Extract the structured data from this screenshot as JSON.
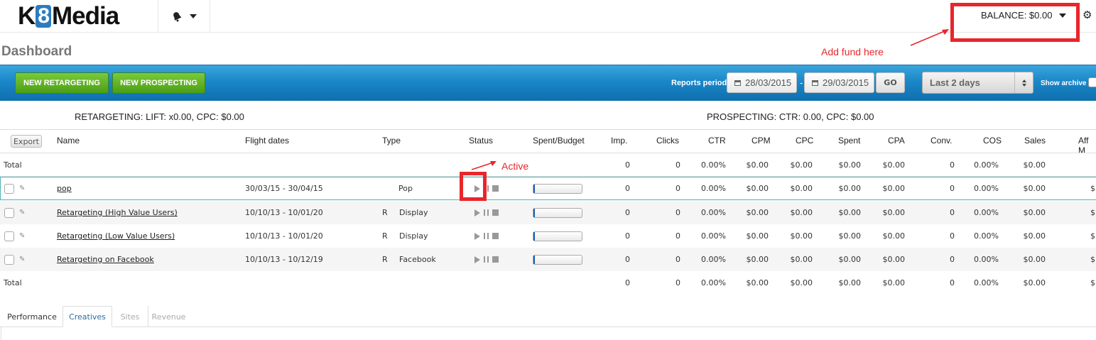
{
  "brand": {
    "pre": "K",
    "box": "8",
    "post": "Media"
  },
  "header": {
    "balance_label": "BALANCE: $0.00",
    "notif_icon": "bell-icon",
    "settings_icon": "gear-icon"
  },
  "page_title": "Dashboard",
  "annotations": {
    "add_fund": "Add fund here",
    "active": "Active",
    "color": "#e8262b"
  },
  "toolbar": {
    "new_retargeting": "NEW RETARGETING",
    "new_prospecting": "NEW PROSPECTING",
    "reports_period_label": "Reports period :",
    "date_from": "28/03/2015",
    "date_sep": "-",
    "date_to": "29/03/2015",
    "go": "GO",
    "period_selected": "Last 2 days",
    "show_archive": "Show archive"
  },
  "summary": {
    "retargeting": "RETARGETING: LIFT: x0.00, CPC: $0.00",
    "prospecting": "PROSPECTING: CTR: 0.00, CPC: $0.00"
  },
  "table": {
    "export": "Export",
    "columns": [
      "Name",
      "Flight dates",
      "Type",
      "Status",
      "Spent/Budget",
      "Imp.",
      "Clicks",
      "CTR",
      "CPM",
      "CPC",
      "Spent",
      "CPA",
      "Conv.",
      "COS",
      "Sales",
      "Aff M"
    ],
    "total_top": {
      "label": "Total",
      "imp": "0",
      "clicks": "0",
      "ctr": "0.00%",
      "cpm": "$0.00",
      "cpc": "$0.00",
      "spent": "$0.00",
      "cpa": "$0.00",
      "conv": "0",
      "cos": "0.00%",
      "sales": "$0.00",
      "aff": ""
    },
    "rows": [
      {
        "name": "pop",
        "flight": "30/03/15 - 30/04/15",
        "prefix": "",
        "type": "Pop",
        "spent_fraction": 0.0,
        "imp": "0",
        "clicks": "0",
        "ctr": "0.00%",
        "cpm": "$0.00",
        "cpc": "$0.00",
        "spent": "$0.00",
        "cpa": "$0.00",
        "conv": "0",
        "cos": "0.00%",
        "sales": "$0.00",
        "aff": "$("
      },
      {
        "name": "Retargeting (High Value Users)",
        "flight": "10/10/13 - 10/01/20",
        "prefix": "R",
        "type": "Display",
        "spent_fraction": 0.0,
        "imp": "0",
        "clicks": "0",
        "ctr": "0.00%",
        "cpm": "$0.00",
        "cpc": "$0.00",
        "spent": "$0.00",
        "cpa": "$0.00",
        "conv": "0",
        "cos": "0.00%",
        "sales": "$0.00",
        "aff": "$("
      },
      {
        "name": "Retargeting (Low Value Users)",
        "flight": "10/10/13 - 10/01/20",
        "prefix": "R",
        "type": "Display",
        "spent_fraction": 0.0,
        "imp": "0",
        "clicks": "0",
        "ctr": "0.00%",
        "cpm": "$0.00",
        "cpc": "$0.00",
        "spent": "$0.00",
        "cpa": "$0.00",
        "conv": "0",
        "cos": "0.00%",
        "sales": "$0.00",
        "aff": "$("
      },
      {
        "name": "Retargeting on Facebook",
        "flight": "10/10/13 - 10/12/19",
        "prefix": "R",
        "type": "Facebook",
        "spent_fraction": 0.0,
        "imp": "0",
        "clicks": "0",
        "ctr": "0.00%",
        "cpm": "$0.00",
        "cpc": "$0.00",
        "spent": "$0.00",
        "cpa": "$0.00",
        "conv": "0",
        "cos": "0.00%",
        "sales": "$0.00",
        "aff": "$("
      }
    ],
    "total_bottom": {
      "label": "Total",
      "imp": "0",
      "clicks": "0",
      "ctr": "0.00%",
      "cpm": "$0.00",
      "cpc": "$0.00",
      "spent": "$0.00",
      "cpa": "$0.00",
      "conv": "0",
      "cos": "0.00%",
      "sales": "$0.00",
      "aff": "$("
    }
  },
  "tabs": [
    {
      "label": "Performance",
      "state": "normal"
    },
    {
      "label": "Creatives",
      "state": "active"
    },
    {
      "label": "Sites",
      "state": "muted"
    },
    {
      "label": "Revenue",
      "state": "muted"
    }
  ],
  "colors": {
    "accent_blue": "#1a87c9",
    "button_green": "#5cae24",
    "annotation_red": "#e8262b"
  }
}
